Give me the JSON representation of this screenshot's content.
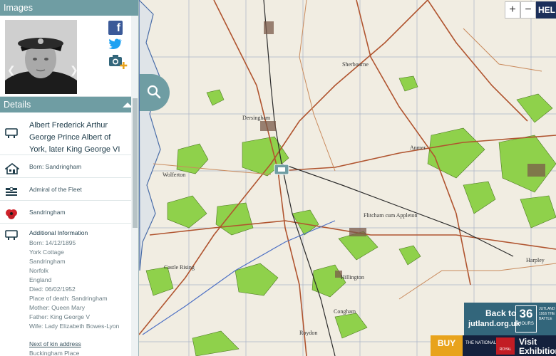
{
  "sidebar": {
    "images_heading": "Images",
    "details_heading": "Details",
    "name": "Albert Frederick Arthur George Prince Albert of York, later King George VI",
    "born": "Born: Sandringham",
    "rank": "Admiral of the Fleet",
    "memorial": "Sandringham",
    "info_title": "Additional Information",
    "info_lines": [
      "Born: 14/12/1895",
      "York Cottage",
      "Sandringham",
      "Norfolk",
      "England",
      "Died: 06/02/1952",
      "Place of death: Sandringham",
      "Mother: Queen Mary",
      "Father: King George V",
      "Wife: Lady Elizabeth Bowes-Lyon"
    ],
    "kin_label": "Next of kin address",
    "kin_value": "Buckingham Place"
  },
  "map": {
    "zoom_in": "+",
    "zoom_out": "−",
    "help_label": "HEL",
    "place_labels": [
      "Sherbourne",
      "Dersingham",
      "Anmer",
      "Wolferton",
      "Castle Rising",
      "Flitcham cum Appleton",
      "Hillington",
      "Congham",
      "Roydon",
      "Harpley"
    ]
  },
  "ads": {
    "jutland_line1": "Back to",
    "jutland_line2": "jutland.org.uk",
    "jutland_hours_number": "36",
    "jutland_hours_unit": "HOURS",
    "jutland_small": "JUTLAND 1916 THE BATTLE",
    "buy_label": "BUY",
    "national_label": "THE NATIONAL",
    "royal_label": "ROYAL",
    "visit_label": "Visit Exhibition"
  },
  "colors": {
    "panel_header": "#6f9da3",
    "map_bg": "#f1ede2",
    "woodland": "#8fd14b",
    "road": "#b0542f",
    "rail": "#2a2a2a"
  }
}
